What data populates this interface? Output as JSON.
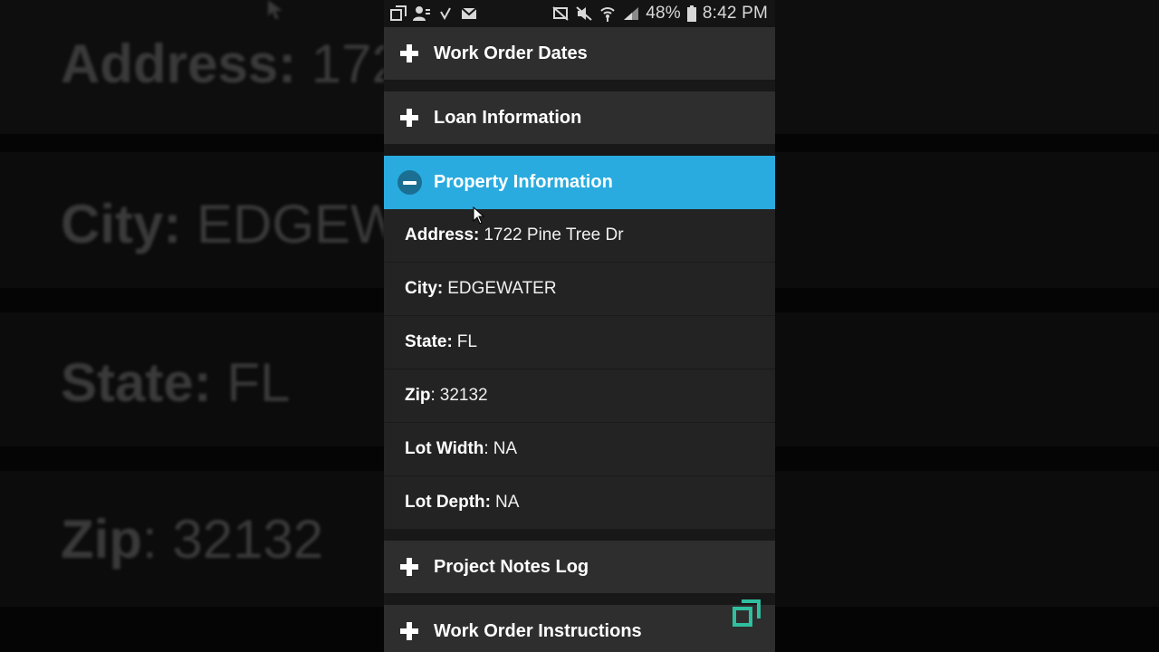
{
  "status_bar": {
    "battery_percent": "48%",
    "time": "8:42 PM",
    "left_icons": [
      "window-restore-icon",
      "contact-icon",
      "check-icon",
      "mail-icon"
    ],
    "right_icons": [
      "cast-icon",
      "mute-icon",
      "wifi-icon",
      "signal-icon",
      "battery-icon"
    ]
  },
  "sections": [
    {
      "label": "Work Order Dates",
      "expanded": false
    },
    {
      "label": "Loan Information",
      "expanded": false
    },
    {
      "label": "Property Information",
      "expanded": true
    },
    {
      "label": "Project Notes Log",
      "expanded": false
    },
    {
      "label": "Work Order Instructions",
      "expanded": false
    }
  ],
  "property": {
    "address": {
      "label": "Address:",
      "value": "1722 Pine Tree Dr"
    },
    "city": {
      "label": "City:",
      "value": "EDGEWATER"
    },
    "state": {
      "label": "State:",
      "value": "FL"
    },
    "zip": {
      "label": "Zip",
      "sep": ":",
      "value": "32132"
    },
    "lot_width": {
      "label": "Lot Width",
      "sep": ":",
      "value": "NA"
    },
    "lot_depth": {
      "label": "Lot Depth:",
      "value": "NA"
    }
  },
  "background_echo": {
    "address": {
      "label": "Address:",
      "value": "172"
    },
    "city": {
      "label": "City:",
      "value": "EDGEW"
    },
    "state": {
      "label": "State:",
      "value": "FL"
    },
    "zip": {
      "label": "Zip",
      "sep": ":",
      "value": "32132"
    }
  },
  "colors": {
    "accent": "#29abdf",
    "header_bg": "#2e2e2e",
    "row_bg": "#232323",
    "float_icon": "#2fbf9f"
  }
}
